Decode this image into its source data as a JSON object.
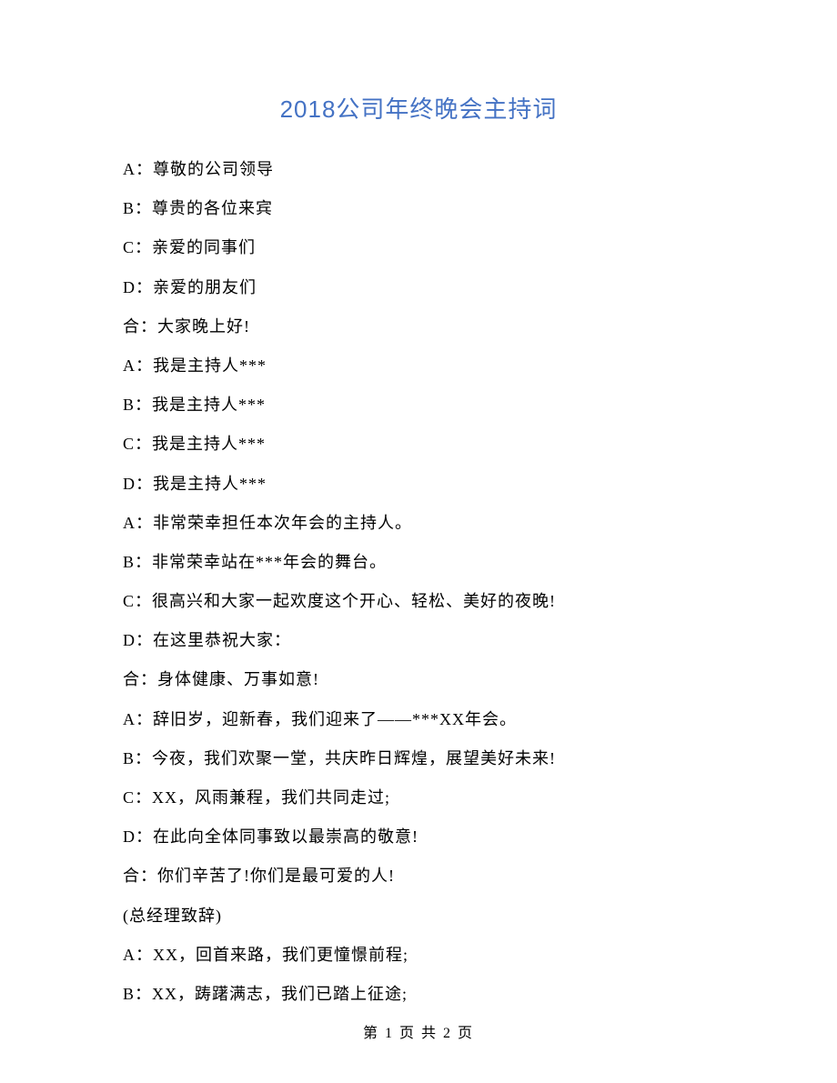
{
  "title": "2018公司年终晚会主持词",
  "lines": [
    "A：尊敬的公司领导",
    "B：尊贵的各位来宾",
    "C：亲爱的同事们",
    "D：亲爱的朋友们",
    "合：大家晚上好!",
    "A：我是主持人***",
    "B：我是主持人***",
    "C：我是主持人***",
    "D：我是主持人***",
    "A：非常荣幸担任本次年会的主持人。",
    "B：非常荣幸站在***年会的舞台。",
    "C：很高兴和大家一起欢度这个开心、轻松、美好的夜晚!",
    "D：在这里恭祝大家：",
    "合：身体健康、万事如意!",
    "A：辞旧岁，迎新春，我们迎来了——***XX年会。",
    "B：今夜，我们欢聚一堂，共庆昨日辉煌，展望美好未来!",
    "C：XX，风雨兼程，我们共同走过;",
    "D：在此向全体同事致以最崇高的敬意!",
    "合：你们辛苦了!你们是最可爱的人!",
    "(总经理致辞)",
    "A：XX，回首来路，我们更憧憬前程;",
    "B：XX，踌躇满志，我们已踏上征途;"
  ],
  "footer": "第 1 页 共 2 页"
}
